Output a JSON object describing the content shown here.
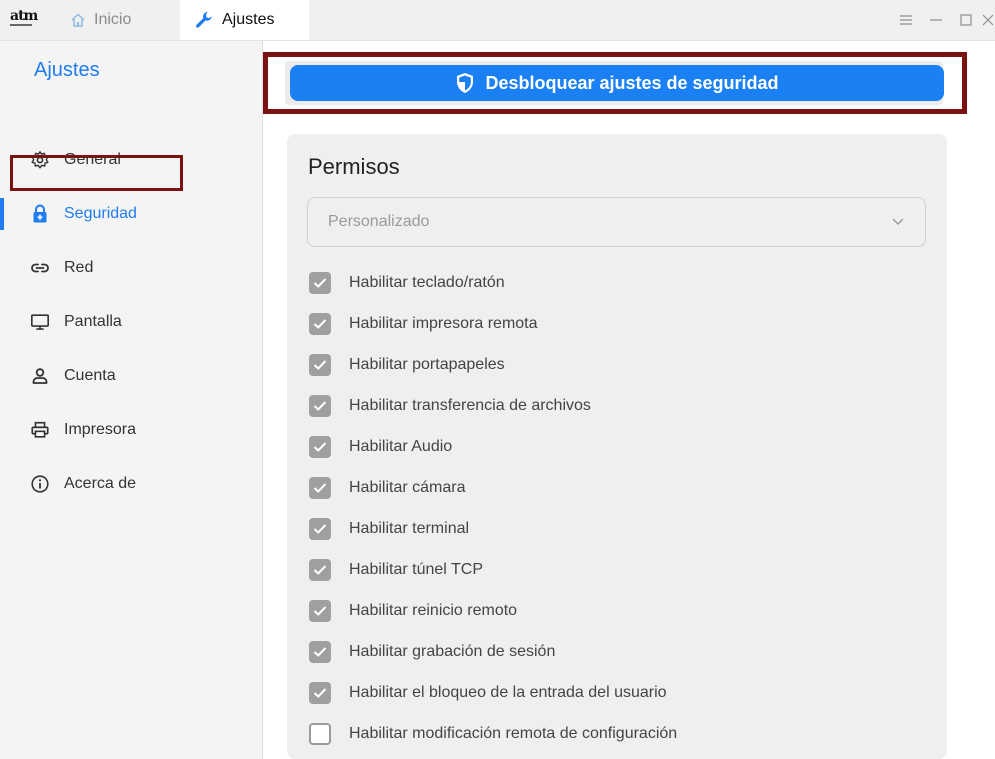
{
  "app": {
    "logo_text": "atm"
  },
  "tabs": [
    {
      "label": "Inicio",
      "icon": "home-icon",
      "active": false
    },
    {
      "label": "Ajustes",
      "icon": "wrench-icon",
      "active": true
    }
  ],
  "window_controls": [
    "menu-icon",
    "minimize-icon",
    "maximize-icon",
    "close-icon"
  ],
  "sidebar": {
    "title": "Ajustes",
    "items": [
      {
        "label": "General",
        "icon": "gear-icon",
        "active": false
      },
      {
        "label": "Seguridad",
        "icon": "lock-icon",
        "active": true
      },
      {
        "label": "Red",
        "icon": "link-icon",
        "active": false
      },
      {
        "label": "Pantalla",
        "icon": "monitor-icon",
        "active": false
      },
      {
        "label": "Cuenta",
        "icon": "user-icon",
        "active": false
      },
      {
        "label": "Impresora",
        "icon": "printer-icon",
        "active": false
      },
      {
        "label": "Acerca de",
        "icon": "info-icon",
        "active": false
      }
    ]
  },
  "main": {
    "unlock_button_label": "Desbloquear ajustes de seguridad",
    "permissions": {
      "title": "Permisos",
      "preset_value": "Personalizado",
      "items": [
        {
          "label": "Habilitar teclado/ratón",
          "checked": true
        },
        {
          "label": "Habilitar impresora remota",
          "checked": true
        },
        {
          "label": "Habilitar portapapeles",
          "checked": true
        },
        {
          "label": "Habilitar transferencia de archivos",
          "checked": true
        },
        {
          "label": "Habilitar Audio",
          "checked": true
        },
        {
          "label": "Habilitar cámara",
          "checked": true
        },
        {
          "label": "Habilitar terminal",
          "checked": true
        },
        {
          "label": "Habilitar túnel TCP",
          "checked": true
        },
        {
          "label": "Habilitar reinicio remoto",
          "checked": true
        },
        {
          "label": "Habilitar grabación de sesión",
          "checked": true
        },
        {
          "label": "Habilitar el bloqueo de la entrada del usuario",
          "checked": true
        },
        {
          "label": "Habilitar modificación remota de configuración",
          "checked": false
        }
      ]
    }
  },
  "colors": {
    "accent": "#1f7cf0",
    "button": "#1a80f4",
    "annotation": "#7a1212",
    "checkbox_on": "#9f9f9f"
  }
}
